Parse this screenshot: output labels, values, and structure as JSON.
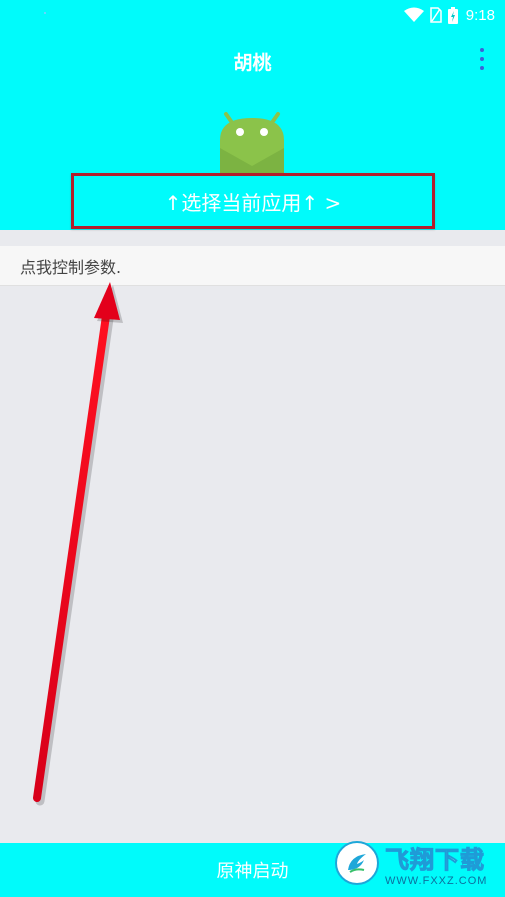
{
  "status_bar": {
    "time": "9:18",
    "icons": [
      "wifi-icon",
      "sim-icon",
      "battery-icon"
    ]
  },
  "header": {
    "title": "胡桃",
    "menu_icon": "more-vert-icon",
    "app_icon": "android-icon",
    "select_app_label": "↑选择当前应用↑ >"
  },
  "params": {
    "label": "点我控制参数."
  },
  "bottom": {
    "launch_label": "原神启动"
  },
  "watermark": {
    "title": "飞翔下载",
    "url": "WWW.FXXZ.COM"
  },
  "colors": {
    "accent": "#00fbfb",
    "highlight_border": "#b21e2b",
    "arrow": "#e3001b",
    "menu_dots": "#3a63d8"
  }
}
